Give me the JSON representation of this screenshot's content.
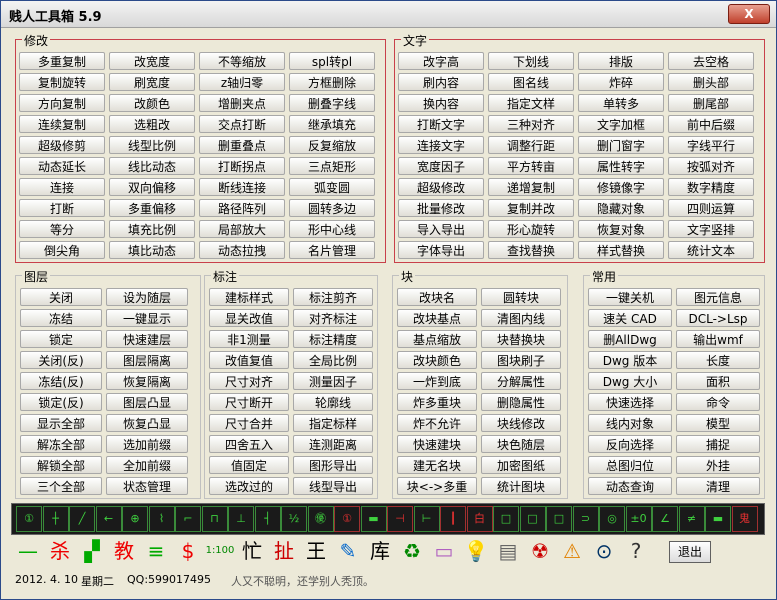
{
  "window": {
    "title": "贱人工具箱 5.9",
    "close_label": "X"
  },
  "groups": {
    "modify": "修改",
    "text": "文字",
    "layer": "图层",
    "dim": "标注",
    "block": "块",
    "common": "常用"
  },
  "modify_buttons": [
    [
      "多重复制",
      "改宽度",
      "不等缩放",
      "spl转pl"
    ],
    [
      "复制旋转",
      "刷宽度",
      "z轴归零",
      "方框删除"
    ],
    [
      "方向复制",
      "改颜色",
      "增删夹点",
      "删叠字线"
    ],
    [
      "连续复制",
      "选粗改",
      "交点打断",
      "继承填充"
    ],
    [
      "超级修剪",
      "线型比例",
      "删重叠点",
      "反复缩放"
    ],
    [
      "动态延长",
      "线比动态",
      "打断拐点",
      "三点矩形"
    ],
    [
      "连接",
      "双向偏移",
      "断线连接",
      "弧变圆"
    ],
    [
      "打断",
      "多重偏移",
      "路径阵列",
      "圆转多边"
    ],
    [
      "等分",
      "填充比例",
      "局部放大",
      "形中心线"
    ],
    [
      "倒尖角",
      "填比动态",
      "动态拉拽",
      "名片管理"
    ]
  ],
  "text_buttons": [
    [
      "改字高",
      "下划线",
      "排版",
      "去空格"
    ],
    [
      "刷内容",
      "图名线",
      "炸碎",
      "删头部"
    ],
    [
      "换内容",
      "指定文样",
      "单转多",
      "删尾部"
    ],
    [
      "打断文字",
      "三种对齐",
      "文字加框",
      "前中后缀"
    ],
    [
      "连接文字",
      "调整行距",
      "删门窗字",
      "字线平行"
    ],
    [
      "宽度因子",
      "平方转亩",
      "属性转字",
      "按弧对齐"
    ],
    [
      "超级修改",
      "递增复制",
      "修镜像字",
      "数字精度"
    ],
    [
      "批量修改",
      "复制并改",
      "隐藏对象",
      "四则运算"
    ],
    [
      "导入导出",
      "形心旋转",
      "恢复对象",
      "文字竖排"
    ],
    [
      "字体导出",
      "查找替换",
      "样式替换",
      "统计文本"
    ]
  ],
  "layer_buttons": [
    [
      "关闭",
      "设为随层"
    ],
    [
      "冻结",
      "一键显示"
    ],
    [
      "锁定",
      "快速建层"
    ],
    [
      "关闭(反)",
      "图层隔离"
    ],
    [
      "冻结(反)",
      "恢复隔离"
    ],
    [
      "锁定(反)",
      "图层凸显"
    ],
    [
      "显示全部",
      "恢复凸显"
    ],
    [
      "解冻全部",
      "选加前缀"
    ],
    [
      "解锁全部",
      "全加前缀"
    ],
    [
      "三个全部",
      "状态管理"
    ]
  ],
  "dim_buttons": [
    [
      "建标样式",
      "标注剪齐"
    ],
    [
      "显关改值",
      "对齐标注"
    ],
    [
      "非1测量",
      "标注精度"
    ],
    [
      "改值复值",
      "全局比例"
    ],
    [
      "尺寸对齐",
      "测量因子"
    ],
    [
      "尺寸断开",
      "轮廓线"
    ],
    [
      "尺寸合并",
      "指定标样"
    ],
    [
      "四舍五入",
      "连测距离"
    ],
    [
      "值固定",
      "图形导出"
    ],
    [
      "选改过的",
      "线型导出"
    ]
  ],
  "block_buttons": [
    [
      "改块名",
      "圆转块"
    ],
    [
      "改块基点",
      "清图内线"
    ],
    [
      "基点缩放",
      "块替换块"
    ],
    [
      "改块颜色",
      "图块刷子"
    ],
    [
      "一炸到底",
      "分解属性"
    ],
    [
      "炸多重块",
      "删隐属性"
    ],
    [
      "炸不允许",
      "块线修改"
    ],
    [
      "快速建块",
      "块色随层"
    ],
    [
      "建无名块",
      "加密图纸"
    ],
    [
      "块<->多重",
      "统计图块"
    ]
  ],
  "common_buttons": [
    [
      "一键关机",
      "图元信息"
    ],
    [
      "速关 CAD",
      "DCL->Lsp"
    ],
    [
      "删AllDwg",
      "输出wmf"
    ],
    [
      "Dwg 版本",
      "长度"
    ],
    [
      "Dwg 大小",
      "面积"
    ],
    [
      "快速选择",
      "命令"
    ],
    [
      "线内对象",
      "模型"
    ],
    [
      "反向选择",
      "捕捉"
    ],
    [
      "总图归位",
      "外挂"
    ],
    [
      "动态查询",
      "清理"
    ]
  ],
  "toolbar1_icons": [
    "①",
    "┼",
    "╱",
    "←",
    "⊕",
    "⌇",
    "⌐",
    "⊓",
    "⊥",
    "┤",
    "½",
    "㊝",
    "①",
    "▬",
    "⊣",
    "⊢",
    "┃",
    "白",
    "□",
    "□",
    "□",
    "⊃",
    "◎",
    "±0",
    "∠",
    "≠",
    "▬",
    "鬼"
  ],
  "toolbar2_icons": [
    "—",
    "杀",
    "▞",
    "教",
    "≡",
    "$",
    "1:100",
    "忙",
    "扯",
    "王",
    "✎",
    "库",
    "♻",
    "▭",
    "💡",
    "▤",
    "☢",
    "⚠",
    "⊙",
    "?"
  ],
  "exit_label": "退出",
  "status": {
    "date": "2012. 4. 10",
    "weekday": "星期二",
    "qq": "QQ:599017495",
    "motto": "人又不聪明，还学别人秃顶。"
  }
}
